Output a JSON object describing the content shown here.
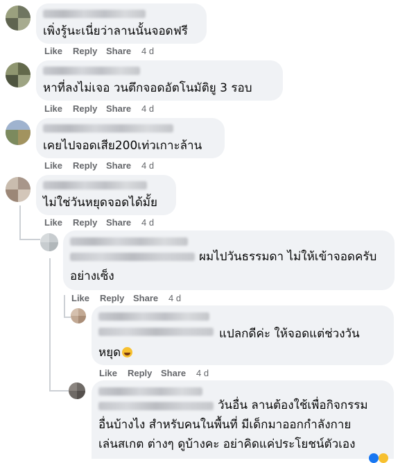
{
  "comments": [
    {
      "text": [
        "เพิ่งรู้นะเนี่ยว่าลานนั้นจอดฟรี"
      ],
      "like": "Like",
      "reply": "Reply",
      "share": "Share",
      "time": "4 d"
    },
    {
      "text": [
        "หาที่ลงไม่เจอ วนตึกจอดอัตโนมัติยู 3 รอบ"
      ],
      "like": "Like",
      "reply": "Reply",
      "share": "Share",
      "time": "4 d"
    },
    {
      "text": [
        "เคยไปจอดเสีย200เท่วเกาะล้าน"
      ],
      "like": "Like",
      "reply": "Reply",
      "share": "Share",
      "time": "4 d"
    },
    {
      "text": [
        "ไม่ใช่วันหยุดจอดได้มั้ย"
      ],
      "like": "Like",
      "reply": "Reply",
      "share": "Share",
      "time": "4 d"
    }
  ],
  "replies": [
    {
      "text": [
        "ผมไปวันธรรมดา ไม่ให้เข้าจอดครับ",
        "อย่างเซ็ง"
      ],
      "like": "Like",
      "reply": "Reply",
      "share": "Share",
      "time": "4 d"
    },
    {
      "text": [
        "แปลกดีค่ะ ให้จอดแต่ช่วงวัน",
        "หยุด"
      ],
      "like": "Like",
      "reply": "Reply",
      "share": "Share",
      "time": "4 d"
    },
    {
      "text": [
        "วันอื่น ลานต้องใช้เพื่อกิจกรรม",
        "อื่นบ้างไง สำหรับคนในพื้นที่ มีเด็กมาออกกำลังกาย",
        "เล่นสเกต ต่างๆ ดูบ้างคะ อย่าคิดแค่ประโยชน์ตัวเอง"
      ]
    }
  ],
  "icons": {
    "reaction_like": "like-reaction-icon",
    "reaction_haha": "haha-reaction-icon",
    "emoji": "laughing-emoji-icon"
  },
  "colors": {
    "bubble": "#f0f2f5",
    "action_text": "#65676b",
    "thread_line": "#ccd0d5"
  }
}
